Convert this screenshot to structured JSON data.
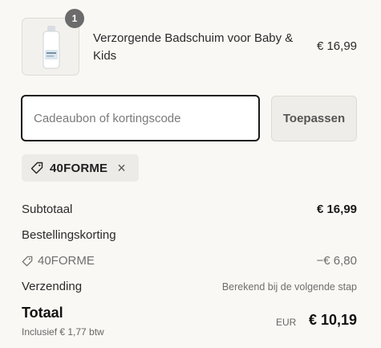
{
  "product": {
    "name": "Verzorgende Badschuim voor Baby & Kids",
    "price": "€ 16,99",
    "quantity": "1",
    "image": "bottle-icon"
  },
  "discount": {
    "placeholder": "Cadeaubon of kortingscode",
    "value": "",
    "apply_label": "Toepassen",
    "applied_code": "40FORME",
    "remove_icon": "close-icon",
    "tag_icon": "tag-icon"
  },
  "summary": {
    "subtotal_label": "Subtotaal",
    "subtotal_value": "€ 16,99",
    "order_discount_label": "Bestellingskorting",
    "code_label": "40FORME",
    "code_value": "−€ 6,80",
    "shipping_label": "Verzending",
    "shipping_value": "Berekend bij de volgende stap",
    "total_label": "Totaal",
    "vat_note": "Inclusief € 1,77 btw",
    "currency": "EUR",
    "total_value": "€ 10,19"
  },
  "colors": {
    "background": "#faf8f4",
    "badge": "#6b6b6b",
    "input_border": "#1a1a1a",
    "button_bg": "#efede9",
    "tag_bg": "#ecebe7"
  }
}
